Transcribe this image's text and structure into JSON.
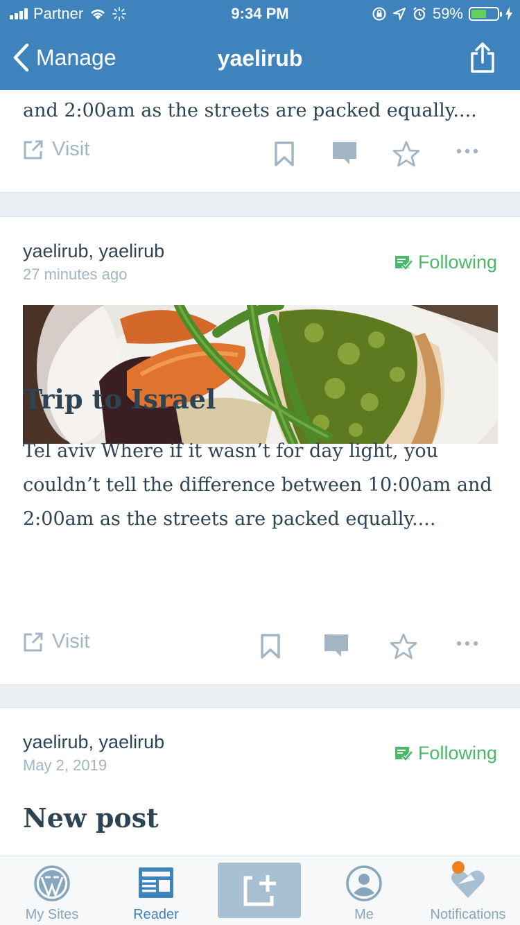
{
  "status_bar": {
    "carrier": "Partner",
    "time": "9:34 PM",
    "battery_percent": "59%",
    "battery_level": 0.59
  },
  "nav": {
    "back_label": "Manage",
    "title": "yaelirub"
  },
  "posts": [
    {
      "excerpt_tail": "and 2:00am as the streets are packed equally....",
      "visit_label": "Visit"
    },
    {
      "authors": "yaelirub, yaelirub",
      "time": "27 minutes ago",
      "follow_label": "Following",
      "title": "Trip to Israel",
      "excerpt": "Tel aviv Where if it wasn’t for day light, you couldn’t tell the difference between 10:00am and 2:00am as the streets are packed equally....",
      "visit_label": "Visit"
    },
    {
      "authors": "yaelirub, yaelirub",
      "time": "May 2, 2019",
      "follow_label": "Following",
      "title": "New post"
    }
  ],
  "tabbar": {
    "items": [
      {
        "label": "My Sites",
        "icon": "wordpress-icon"
      },
      {
        "label": "Reader",
        "icon": "reader-icon"
      },
      {
        "label": "",
        "icon": "compose-icon"
      },
      {
        "label": "Me",
        "icon": "person-icon"
      },
      {
        "label": "Notifications",
        "icon": "bell-heart-icon"
      }
    ],
    "active": "Reader"
  },
  "colors": {
    "brand_blue": "#3f83bd",
    "following_green": "#4ab866",
    "text_dark": "#2e4453",
    "text_muted": "#a2b5c2",
    "notification_dot": "#f0821e"
  }
}
